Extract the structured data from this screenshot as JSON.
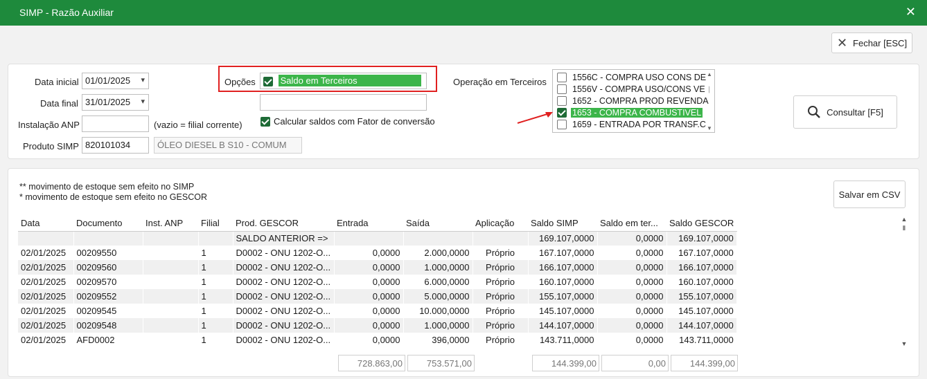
{
  "window": {
    "title": "SIMP - Razão Auxiliar"
  },
  "toolbar": {
    "close_label": "Fechar [ESC]"
  },
  "filters": {
    "data_inicial_label": "Data inicial",
    "data_inicial_value": "01/01/2025",
    "data_final_label": "Data final",
    "data_final_value": "31/01/2025",
    "instalacao_label": "Instalação ANP",
    "instalacao_value": "",
    "instalacao_hint": "(vazio = filial corrente)",
    "produto_label": "Produto SIMP",
    "produto_code": "820101034",
    "produto_desc": "ÓLEO DIESEL B S10 - COMUM",
    "opcoes_label": "Opções",
    "opcoes_selected": "Saldo em Terceiros",
    "opcoes_second": "",
    "fator_label": "Calcular saldos com Fator de conversão",
    "operacao_label": "Operação em Terceiros",
    "consultar_label": "Consultar [F5]"
  },
  "operacoes": [
    {
      "label": "1556C - COMPRA USO CONS DE",
      "checked": false
    },
    {
      "label": "1556V - COMPRA USO/CONS VE",
      "checked": false
    },
    {
      "label": "1652 - COMPRA PROD REVENDA",
      "checked": false
    },
    {
      "label": "1653 - COMPRA COMBUSTIVEL",
      "checked": true
    },
    {
      "label": "1659 - ENTRADA POR TRANSF.C",
      "checked": false
    }
  ],
  "notes": {
    "note1": "** movimento de estoque sem efeito no SIMP",
    "note2": "* movimento de estoque sem efeito no GESCOR",
    "save_csv_label": "Salvar em CSV"
  },
  "table": {
    "headers": [
      "Data",
      "Documento",
      "Inst. ANP",
      "Filial",
      "Prod. GESCOR",
      "Entrada",
      "Saída",
      "Aplicação",
      "Saldo SIMP",
      "Saldo em ter...",
      "Saldo GESCOR"
    ],
    "rows": [
      [
        "",
        "",
        "",
        "",
        "SALDO ANTERIOR =>",
        "",
        "",
        "",
        "169.107,0000",
        "0,0000",
        "169.107,0000"
      ],
      [
        "02/01/2025",
        "00209550",
        "",
        "1",
        "D0002 - ONU 1202-O...",
        "0,0000",
        "2.000,0000",
        "Próprio",
        "167.107,0000",
        "0,0000",
        "167.107,0000"
      ],
      [
        "02/01/2025",
        "00209560",
        "",
        "1",
        "D0002 - ONU 1202-O...",
        "0,0000",
        "1.000,0000",
        "Próprio",
        "166.107,0000",
        "0,0000",
        "166.107,0000"
      ],
      [
        "02/01/2025",
        "00209570",
        "",
        "1",
        "D0002 - ONU 1202-O...",
        "0,0000",
        "6.000,0000",
        "Próprio",
        "160.107,0000",
        "0,0000",
        "160.107,0000"
      ],
      [
        "02/01/2025",
        "00209552",
        "",
        "1",
        "D0002 - ONU 1202-O...",
        "0,0000",
        "5.000,0000",
        "Próprio",
        "155.107,0000",
        "0,0000",
        "155.107,0000"
      ],
      [
        "02/01/2025",
        "00209545",
        "",
        "1",
        "D0002 - ONU 1202-O...",
        "0,0000",
        "10.000,0000",
        "Próprio",
        "145.107,0000",
        "0,0000",
        "145.107,0000"
      ],
      [
        "02/01/2025",
        "00209548",
        "",
        "1",
        "D0002 - ONU 1202-O...",
        "0,0000",
        "1.000,0000",
        "Próprio",
        "144.107,0000",
        "0,0000",
        "144.107,0000"
      ],
      [
        "02/01/2025",
        "AFD0002",
        "",
        "1",
        "D0002 - ONU 1202-O...",
        "0,0000",
        "396,0000",
        "Próprio",
        "143.711,0000",
        "0,0000",
        "143.711,0000"
      ]
    ]
  },
  "totals": {
    "entrada": "728.863,00",
    "saida": "753.571,00",
    "saldo_simp": "144.399,00",
    "saldo_terceiros": "0,00",
    "saldo_gescor": "144.399,00"
  },
  "colors": {
    "titlebar": "#1e8a3c",
    "highlight": "#3cb54a",
    "annotation": "#e02020"
  }
}
